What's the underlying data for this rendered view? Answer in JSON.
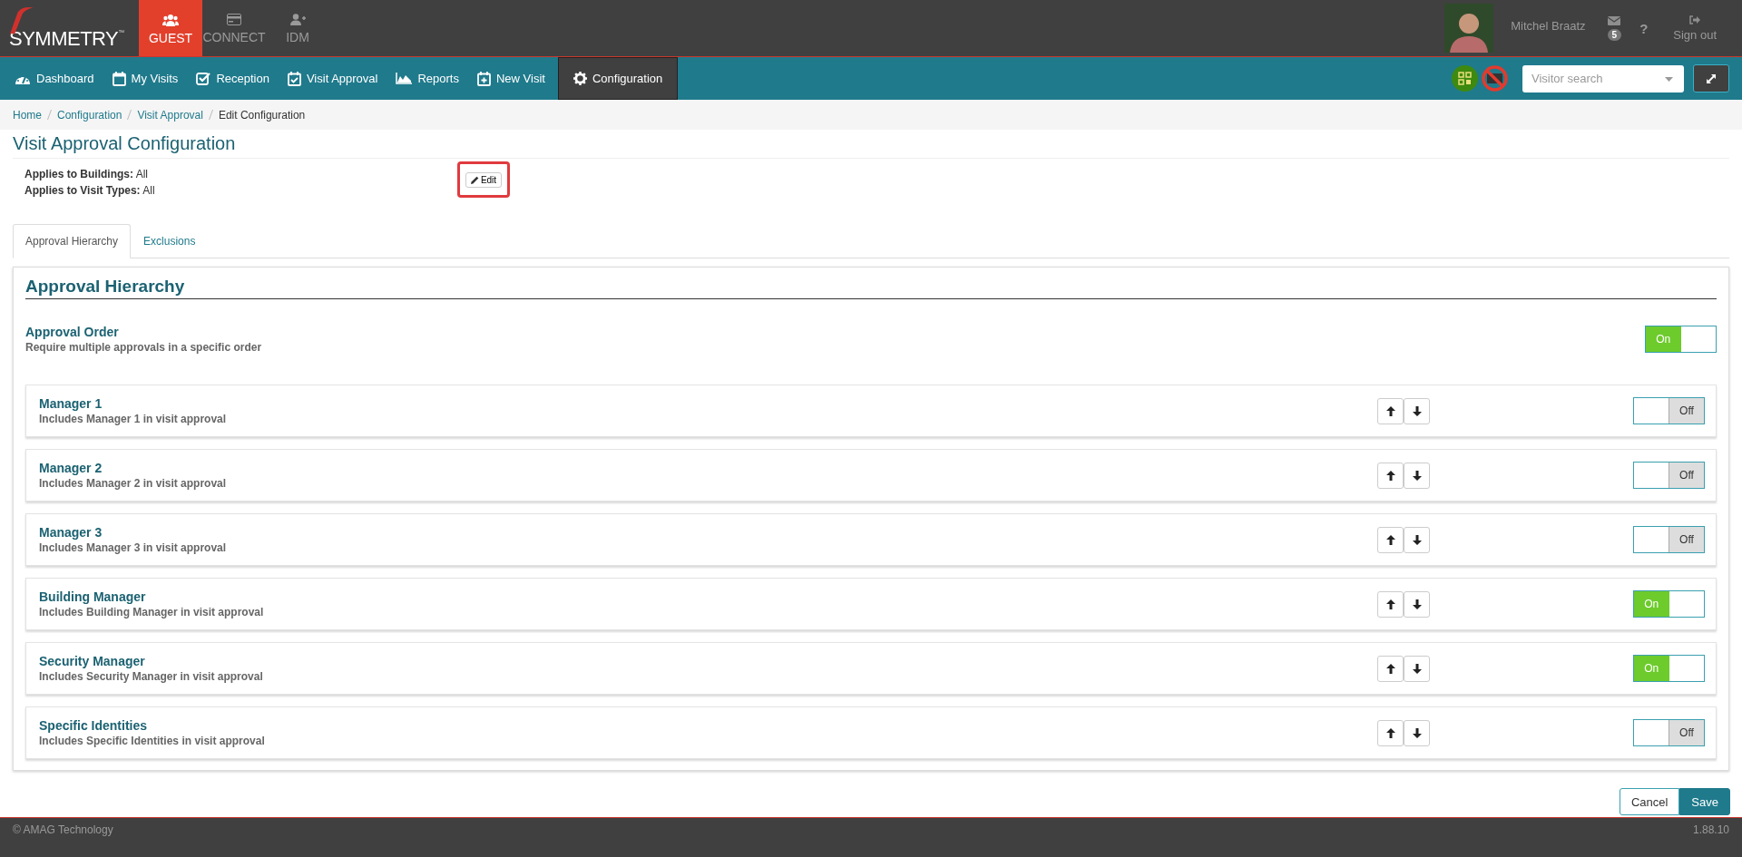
{
  "top_bar": {
    "logo": "SYMMETRY",
    "logo_mark": "™",
    "apps": [
      {
        "label": "GUEST",
        "kind": "guest",
        "selected": true
      },
      {
        "label": "CONNECT",
        "kind": "card",
        "selected": false
      },
      {
        "label": "IDM",
        "kind": "user-add",
        "selected": false
      }
    ],
    "user_name": "Mitchel Braatz",
    "mail_count": "5",
    "help": "?",
    "sign_out": "Sign out"
  },
  "nav": {
    "items": [
      {
        "label": "Dashboard",
        "kind": "gauge",
        "selected": false
      },
      {
        "label": "My Visits",
        "kind": "calendar",
        "selected": false
      },
      {
        "label": "Reception",
        "kind": "check",
        "selected": false
      },
      {
        "label": "Visit Approval",
        "kind": "calendar-check",
        "selected": false
      },
      {
        "label": "Reports",
        "kind": "area",
        "selected": false
      },
      {
        "label": "New Visit",
        "kind": "calendar-plus",
        "selected": false
      },
      {
        "label": "Configuration",
        "kind": "gear",
        "selected": true
      }
    ],
    "search": {
      "placeholder": "Visitor search"
    }
  },
  "breadcrumbs": [
    "Home",
    "Configuration",
    "Visit Approval",
    "Edit Configuration"
  ],
  "page_title": "Visit Approval Configuration",
  "applies": [
    {
      "label": "Applies to Buildings:",
      "value": "All"
    },
    {
      "label": "Applies to Visit Types:",
      "value": "All"
    }
  ],
  "edit_button": "Edit",
  "tabs": [
    {
      "label": "Approval Hierarchy",
      "selected": true
    },
    {
      "label": "Exclusions",
      "selected": false
    }
  ],
  "section_heading": "Approval Hierarchy",
  "approval_order": {
    "title": "Approval Order",
    "description": "Require multiple approvals in a specific order",
    "on": true,
    "toggle_text": "On"
  },
  "approvers": [
    {
      "title": "Manager 1",
      "description": "Includes Manager 1 in visit approval",
      "on": false,
      "toggle_text": "Off"
    },
    {
      "title": "Manager 2",
      "description": "Includes Manager 2 in visit approval",
      "on": false,
      "toggle_text": "Off"
    },
    {
      "title": "Manager 3",
      "description": "Includes Manager 3 in visit approval",
      "on": false,
      "toggle_text": "Off"
    },
    {
      "title": "Building Manager",
      "description": "Includes Building Manager in visit approval",
      "on": true,
      "toggle_text": "On"
    },
    {
      "title": "Security Manager",
      "description": "Includes Security Manager in visit approval",
      "on": true,
      "toggle_text": "On"
    },
    {
      "title": "Specific Identities",
      "description": "Includes Specific Identities in visit approval",
      "on": false,
      "toggle_text": "Off"
    }
  ],
  "buttons": {
    "cancel": "Cancel",
    "save": "Save"
  },
  "footer": {
    "copyright": "© AMAG Technology",
    "version": "1.88.10"
  }
}
